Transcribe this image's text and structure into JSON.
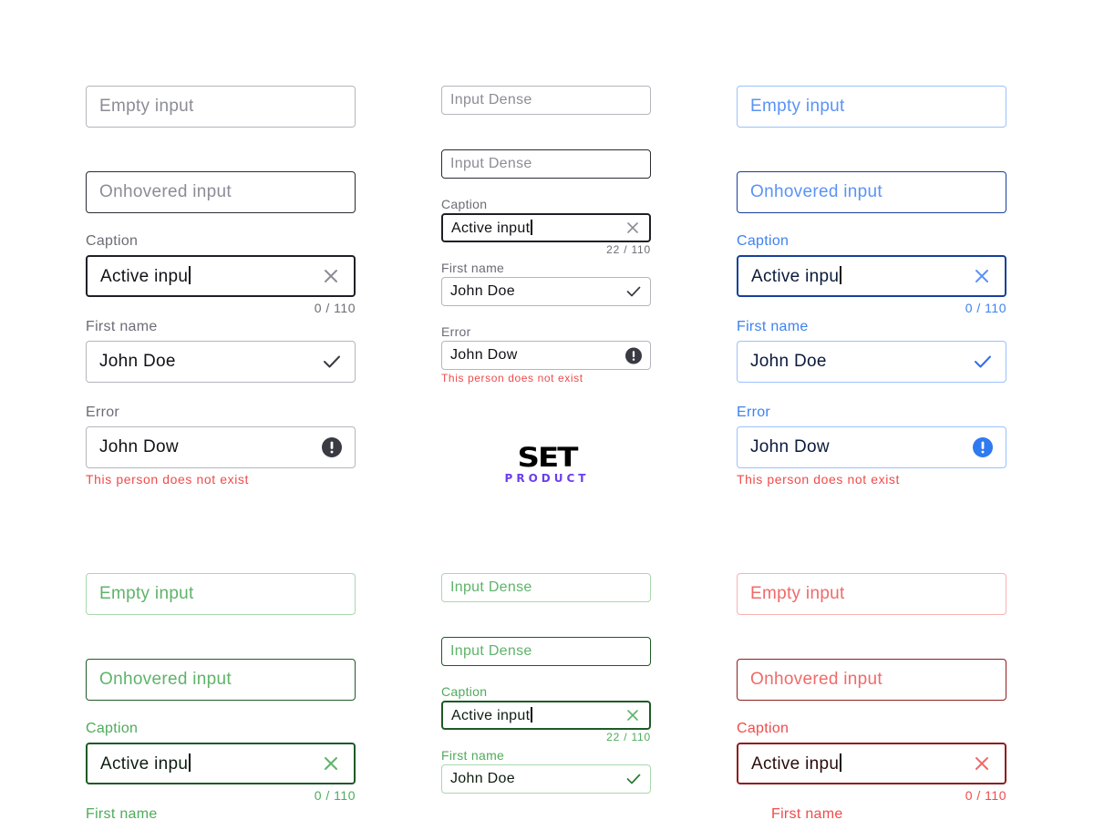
{
  "colors": {
    "gray_accent": "#1f1f26",
    "blue_accent": "#3d82f0",
    "green_accent": "#4fab5b",
    "red_accent": "#ef4b4b",
    "error_text": "#ef4b4b",
    "logo_purple": "#6b3df0"
  },
  "logo": {
    "top": "SET",
    "bottom": "PRODUCT"
  },
  "gray": {
    "empty_placeholder": "Empty input",
    "hover_placeholder": "Onhovered input",
    "active_label": "Caption",
    "active_value": "Active inpu",
    "active_counter": "0 / 110",
    "active_icon": "close-icon",
    "filled_label": "First name",
    "filled_value": "John Doe",
    "filled_icon": "check-icon",
    "error_label": "Error",
    "error_value": "John Dow",
    "error_icon": "alert-icon",
    "error_message": "This person does not exist"
  },
  "gray_dense": {
    "empty_placeholder": "Input Dense",
    "hover_placeholder": "Input Dense",
    "active_label": "Caption",
    "active_value": "Active input",
    "active_counter": "22 / 110",
    "filled_label": "First name",
    "filled_value": "John Doe",
    "error_label": "Error",
    "error_value": "John Dow",
    "error_message": "This person does not exist"
  },
  "blue": {
    "empty_placeholder": "Empty input",
    "hover_placeholder": "Onhovered input",
    "active_label": "Caption",
    "active_value": "Active inpu",
    "active_counter": "0 / 110",
    "filled_label": "First name",
    "filled_value": "John Doe",
    "error_label": "Error",
    "error_value": "John Dow",
    "error_message": "This person does not exist"
  },
  "green": {
    "empty_placeholder": "Empty input",
    "hover_placeholder": "Onhovered input",
    "active_label": "Caption",
    "active_value": "Active inpu",
    "active_counter": "0 / 110",
    "filled_label": "First name"
  },
  "green_dense": {
    "empty_placeholder": "Input Dense",
    "hover_placeholder": "Input Dense",
    "active_label": "Caption",
    "active_value": "Active input",
    "active_counter": "22 / 110",
    "filled_label": "First name",
    "filled_value": "John Doe"
  },
  "red": {
    "empty_placeholder": "Empty input",
    "hover_placeholder": "Onhovered input",
    "active_label": "Caption",
    "active_value": "Active inpu",
    "active_counter": "0 / 110",
    "filled_label": "First name"
  }
}
